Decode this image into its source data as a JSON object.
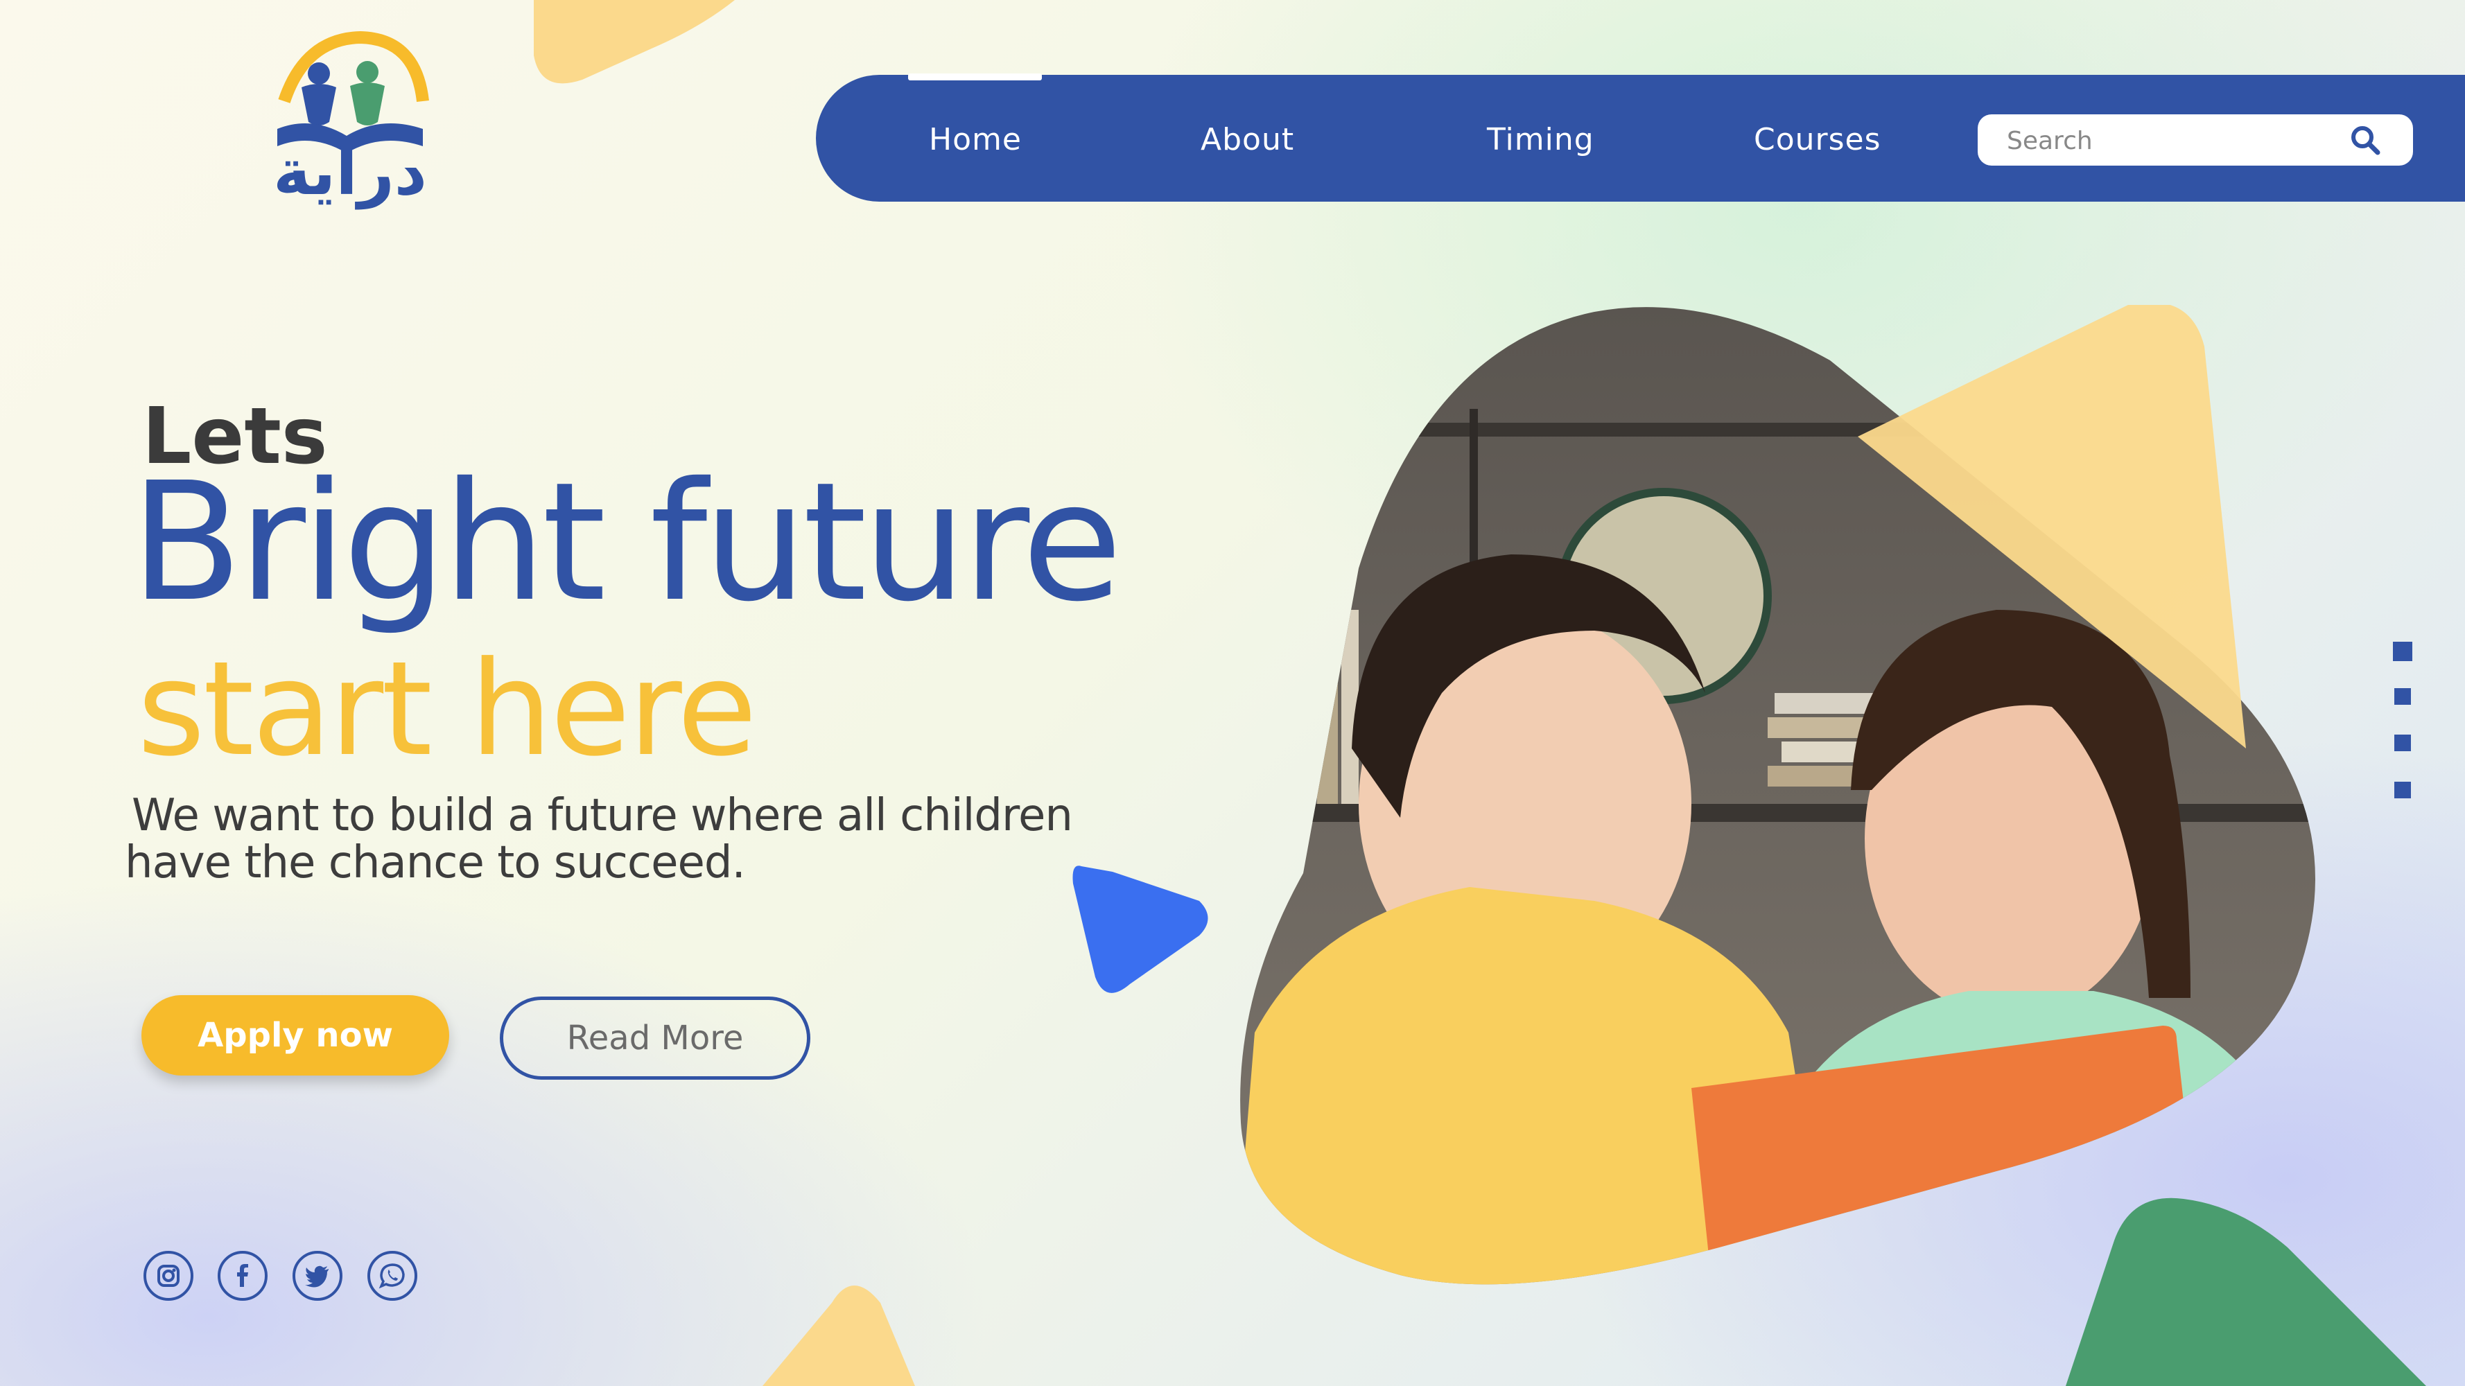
{
  "brand": {
    "logo_text": "دراية",
    "colors": {
      "primary": "#3153a5",
      "accent": "#f7bb2b",
      "green": "#4a9d6f",
      "blue": "#3a6ff0"
    }
  },
  "nav": {
    "items": [
      {
        "label": "Home"
      },
      {
        "label": "About"
      },
      {
        "label": "Timing"
      },
      {
        "label": "Courses"
      }
    ],
    "search": {
      "placeholder": "Search",
      "icon": "search-icon"
    }
  },
  "hero": {
    "lets": "Lets",
    "headline": "Bright future",
    "subheadline": "start here",
    "description_line1": "We want to build a future where all children",
    "description_line2": "have the chance to succeed.",
    "apply_label": "Apply now",
    "read_more_label": "Read More",
    "image_alt": "Two children reading a book together"
  },
  "social": [
    {
      "icon": "instagram-icon"
    },
    {
      "icon": "facebook-icon"
    },
    {
      "icon": "twitter-icon"
    },
    {
      "icon": "whatsapp-icon"
    }
  ]
}
